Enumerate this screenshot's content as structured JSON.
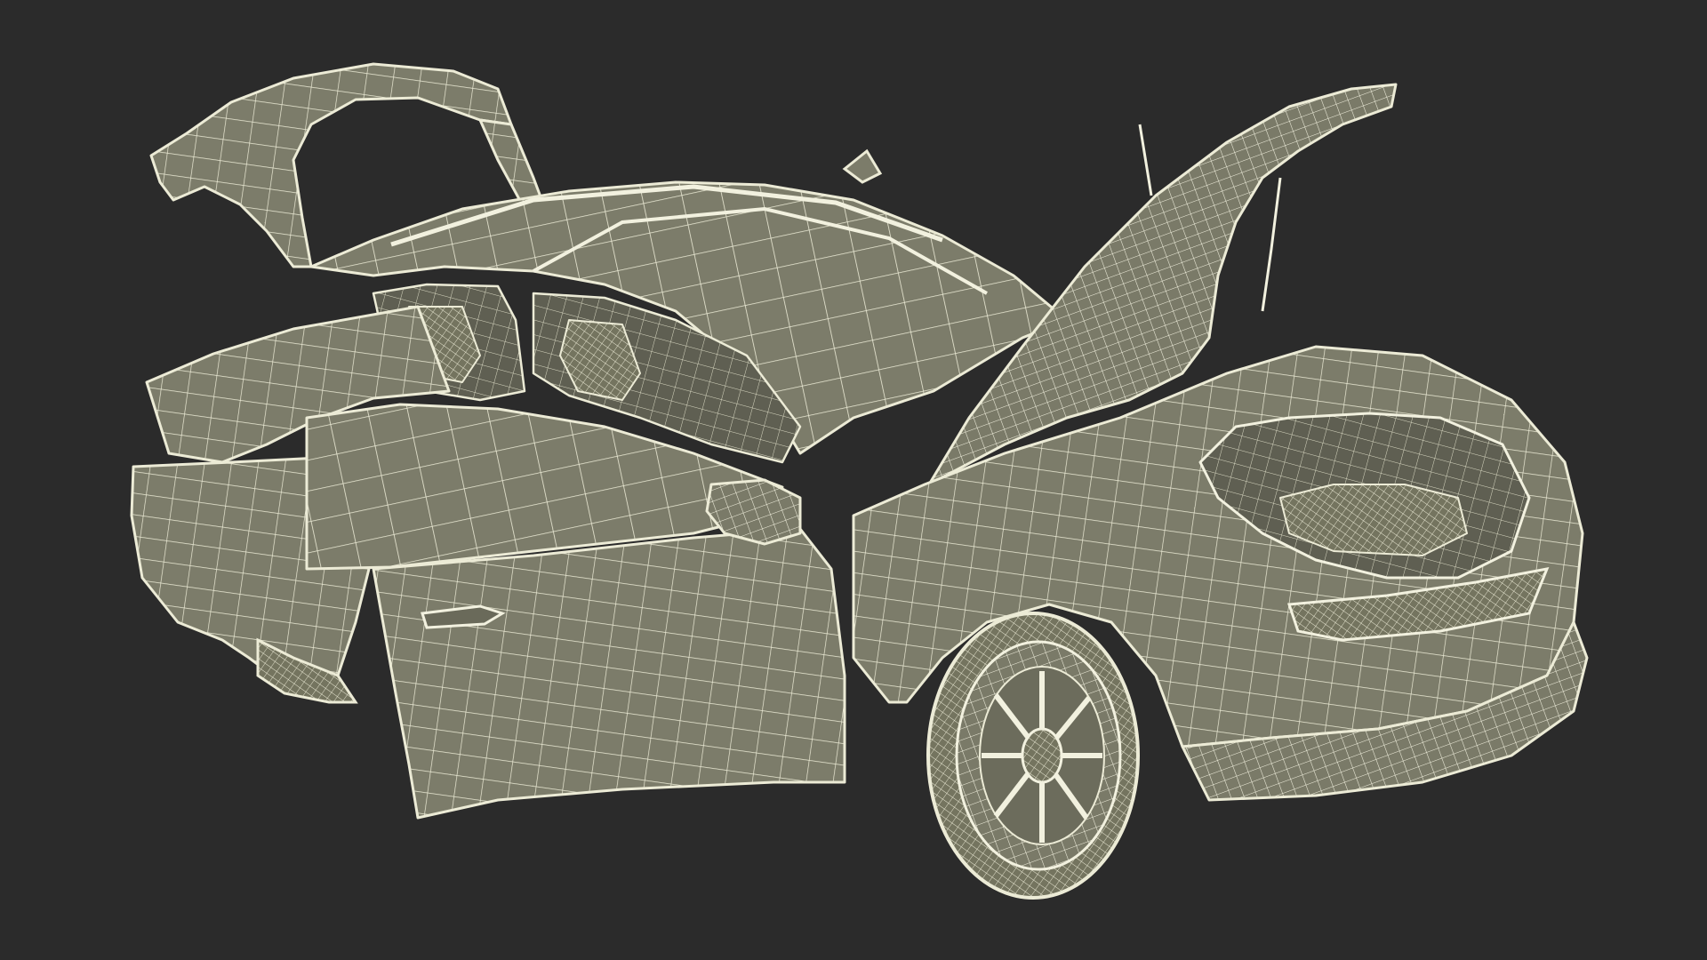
{
  "scene": {
    "subject": "",
    "render_style": "wireframe",
    "colors": {
      "background": "#2b2b2b",
      "surface": "#7c7c6a",
      "surface_dark": "#5f5f52",
      "surface_light": "#8a8a76",
      "wire": "#ecebd6",
      "wire_dense": "#f2f1df"
    }
  }
}
